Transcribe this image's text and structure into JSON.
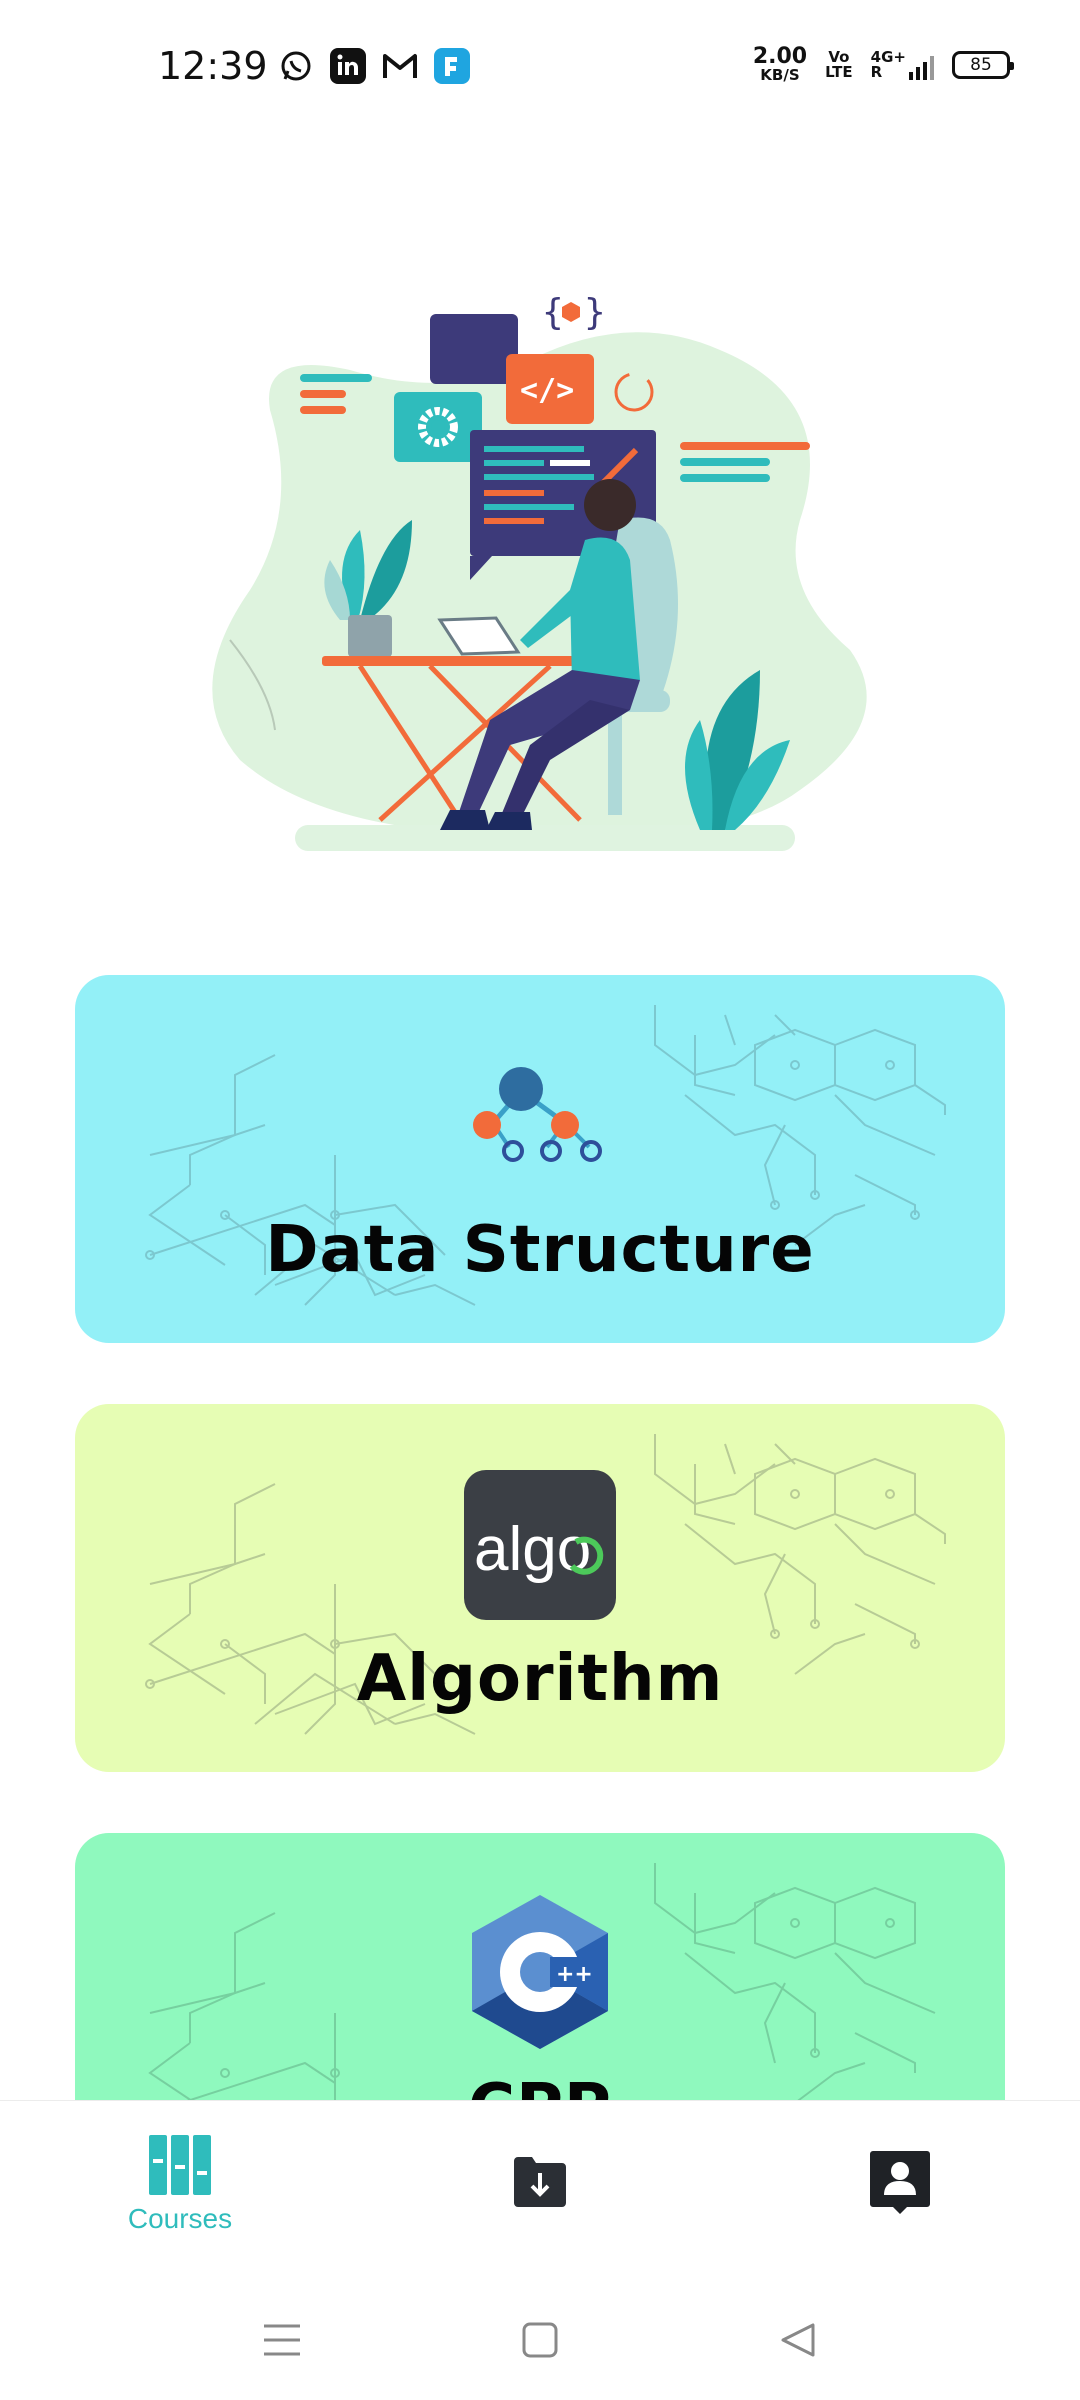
{
  "status_bar": {
    "time": "12:39",
    "net_speed_value": "2.00",
    "net_speed_unit": "KB/S",
    "volte_top": "Vo",
    "volte_bottom": "LTE",
    "network": "4G+",
    "network_r": "R",
    "battery": "85",
    "app_icons": [
      "whatsapp-icon",
      "linkedin-icon",
      "gmail-icon",
      "app-icon"
    ]
  },
  "courses": [
    {
      "title": "Data Structure",
      "color": "#93f0f7",
      "icon": "tree-structure-icon"
    },
    {
      "title": "Algorithm",
      "color": "#e6fdb4",
      "icon": "algo-logo-icon",
      "logo_text": "algo"
    },
    {
      "title": "CPP",
      "color": "#8ff9be",
      "icon": "cpp-logo-icon",
      "logo_text": "C++"
    }
  ],
  "bottom_nav": {
    "courses_label": "Courses",
    "active_color": "#2fbcbc",
    "items": [
      "books-icon",
      "download-icon",
      "profile-icon"
    ]
  },
  "colors": {
    "ds_card": "#93f0f7",
    "algo_card": "#e6fdb4",
    "cpp_card": "#8ff9be",
    "teal_accent": "#2fbcbc",
    "orange_accent": "#f26b3a"
  }
}
